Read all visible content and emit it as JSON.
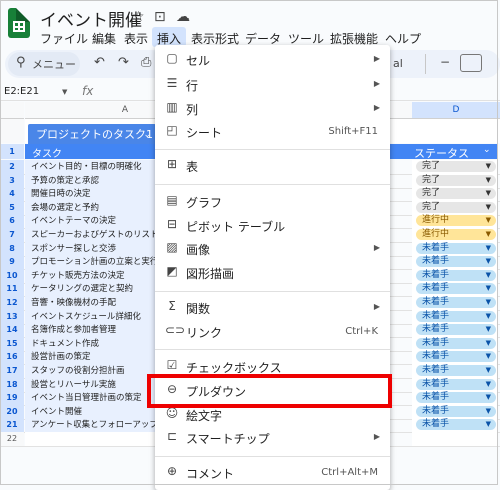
{
  "doc": {
    "title": "イベント開催"
  },
  "menubar": [
    "ファイル",
    "編集",
    "表示",
    "挿入",
    "表示形式",
    "データ",
    "ツール",
    "拡張機能",
    "ヘルプ"
  ],
  "toolbar": {
    "search_label": "メニュー",
    "font_fragment": "al"
  },
  "namebox": {
    "value": "E2:E21",
    "fx": "fx"
  },
  "columns": {
    "a": "A",
    "d": "D"
  },
  "table": {
    "title": "プロジェクトのタスク1",
    "header_a": "タスク",
    "header_status": "ステータス"
  },
  "rows": [
    {
      "num": "1",
      "task": "タスク",
      "status": ""
    },
    {
      "num": "2",
      "task": "イベント目的・目標の明確化",
      "status": "完了"
    },
    {
      "num": "3",
      "task": "予算の策定と承認",
      "status": "完了"
    },
    {
      "num": "4",
      "task": "開催日時の決定",
      "status": "完了"
    },
    {
      "num": "5",
      "task": "会場の選定と予約",
      "status": "完了"
    },
    {
      "num": "6",
      "task": "イベントテーマの決定",
      "status": "進行中"
    },
    {
      "num": "7",
      "task": "スピーカーおよびゲストのリストア",
      "status": "進行中"
    },
    {
      "num": "8",
      "task": "スポンサー探しと交渉",
      "status": "未着手"
    },
    {
      "num": "9",
      "task": "プロモーション計画の立案と実行",
      "status": "未着手"
    },
    {
      "num": "10",
      "task": "チケット販売方法の決定",
      "status": "未着手"
    },
    {
      "num": "11",
      "task": "ケータリングの選定と契約",
      "status": "未着手"
    },
    {
      "num": "12",
      "task": "音響・映像機材の手配",
      "status": "未着手"
    },
    {
      "num": "13",
      "task": "イベントスケジュール詳細化",
      "status": "未着手"
    },
    {
      "num": "14",
      "task": "名簿作成と参加者管理",
      "status": "未着手"
    },
    {
      "num": "15",
      "task": "ドキュメント作成",
      "status": "未着手"
    },
    {
      "num": "16",
      "task": "設営計画の策定",
      "status": "未着手"
    },
    {
      "num": "17",
      "task": "スタッフの役割分担計画",
      "status": "未着手"
    },
    {
      "num": "18",
      "task": "設営とリハーサル実施",
      "status": "未着手"
    },
    {
      "num": "19",
      "task": "イベント当日管理計画の策定",
      "status": "未着手"
    },
    {
      "num": "20",
      "task": "イベント開催",
      "status": "未着手"
    },
    {
      "num": "21",
      "task": "アンケート収集とフォローアップ",
      "status": "未着手"
    },
    {
      "num": "22",
      "task": "",
      "status": ""
    }
  ],
  "insert_menu": {
    "cell": "セル",
    "row": "行",
    "column": "列",
    "sheet": "シート",
    "sheet_shortcut": "Shift+F11",
    "table": "表",
    "chart": "グラフ",
    "pivot": "ピボット テーブル",
    "image": "画像",
    "drawing": "図形描画",
    "function": "関数",
    "link": "リンク",
    "link_shortcut": "Ctrl+K",
    "checkbox": "チェックボックス",
    "dropdown": "プルダウン",
    "emoji": "絵文字",
    "smartchip": "スマートチップ",
    "comment": "コメント",
    "comment_shortcut": "Ctrl+Alt+M"
  },
  "colors": {
    "accent": "#4285f4",
    "highlight": "#e00000",
    "done": "#e6e6e6",
    "in_progress": "#ffe599",
    "todo": "#bfe1f6"
  }
}
